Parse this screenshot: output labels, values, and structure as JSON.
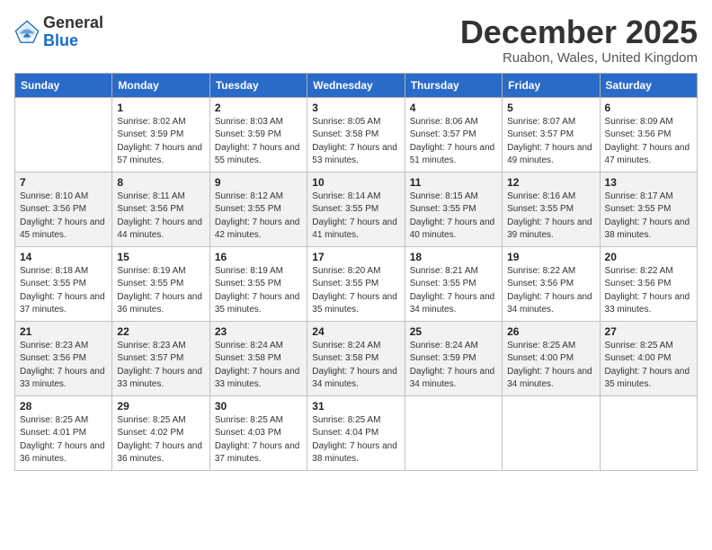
{
  "header": {
    "logo_line1": "General",
    "logo_line2": "Blue",
    "month_year": "December 2025",
    "location": "Ruabon, Wales, United Kingdom"
  },
  "weekdays": [
    "Sunday",
    "Monday",
    "Tuesday",
    "Wednesday",
    "Thursday",
    "Friday",
    "Saturday"
  ],
  "weeks": [
    [
      {
        "day": "",
        "sunrise": "",
        "sunset": "",
        "daylight": ""
      },
      {
        "day": "1",
        "sunrise": "Sunrise: 8:02 AM",
        "sunset": "Sunset: 3:59 PM",
        "daylight": "Daylight: 7 hours and 57 minutes."
      },
      {
        "day": "2",
        "sunrise": "Sunrise: 8:03 AM",
        "sunset": "Sunset: 3:59 PM",
        "daylight": "Daylight: 7 hours and 55 minutes."
      },
      {
        "day": "3",
        "sunrise": "Sunrise: 8:05 AM",
        "sunset": "Sunset: 3:58 PM",
        "daylight": "Daylight: 7 hours and 53 minutes."
      },
      {
        "day": "4",
        "sunrise": "Sunrise: 8:06 AM",
        "sunset": "Sunset: 3:57 PM",
        "daylight": "Daylight: 7 hours and 51 minutes."
      },
      {
        "day": "5",
        "sunrise": "Sunrise: 8:07 AM",
        "sunset": "Sunset: 3:57 PM",
        "daylight": "Daylight: 7 hours and 49 minutes."
      },
      {
        "day": "6",
        "sunrise": "Sunrise: 8:09 AM",
        "sunset": "Sunset: 3:56 PM",
        "daylight": "Daylight: 7 hours and 47 minutes."
      }
    ],
    [
      {
        "day": "7",
        "sunrise": "Sunrise: 8:10 AM",
        "sunset": "Sunset: 3:56 PM",
        "daylight": "Daylight: 7 hours and 45 minutes."
      },
      {
        "day": "8",
        "sunrise": "Sunrise: 8:11 AM",
        "sunset": "Sunset: 3:56 PM",
        "daylight": "Daylight: 7 hours and 44 minutes."
      },
      {
        "day": "9",
        "sunrise": "Sunrise: 8:12 AM",
        "sunset": "Sunset: 3:55 PM",
        "daylight": "Daylight: 7 hours and 42 minutes."
      },
      {
        "day": "10",
        "sunrise": "Sunrise: 8:14 AM",
        "sunset": "Sunset: 3:55 PM",
        "daylight": "Daylight: 7 hours and 41 minutes."
      },
      {
        "day": "11",
        "sunrise": "Sunrise: 8:15 AM",
        "sunset": "Sunset: 3:55 PM",
        "daylight": "Daylight: 7 hours and 40 minutes."
      },
      {
        "day": "12",
        "sunrise": "Sunrise: 8:16 AM",
        "sunset": "Sunset: 3:55 PM",
        "daylight": "Daylight: 7 hours and 39 minutes."
      },
      {
        "day": "13",
        "sunrise": "Sunrise: 8:17 AM",
        "sunset": "Sunset: 3:55 PM",
        "daylight": "Daylight: 7 hours and 38 minutes."
      }
    ],
    [
      {
        "day": "14",
        "sunrise": "Sunrise: 8:18 AM",
        "sunset": "Sunset: 3:55 PM",
        "daylight": "Daylight: 7 hours and 37 minutes."
      },
      {
        "day": "15",
        "sunrise": "Sunrise: 8:19 AM",
        "sunset": "Sunset: 3:55 PM",
        "daylight": "Daylight: 7 hours and 36 minutes."
      },
      {
        "day": "16",
        "sunrise": "Sunrise: 8:19 AM",
        "sunset": "Sunset: 3:55 PM",
        "daylight": "Daylight: 7 hours and 35 minutes."
      },
      {
        "day": "17",
        "sunrise": "Sunrise: 8:20 AM",
        "sunset": "Sunset: 3:55 PM",
        "daylight": "Daylight: 7 hours and 35 minutes."
      },
      {
        "day": "18",
        "sunrise": "Sunrise: 8:21 AM",
        "sunset": "Sunset: 3:55 PM",
        "daylight": "Daylight: 7 hours and 34 minutes."
      },
      {
        "day": "19",
        "sunrise": "Sunrise: 8:22 AM",
        "sunset": "Sunset: 3:56 PM",
        "daylight": "Daylight: 7 hours and 34 minutes."
      },
      {
        "day": "20",
        "sunrise": "Sunrise: 8:22 AM",
        "sunset": "Sunset: 3:56 PM",
        "daylight": "Daylight: 7 hours and 33 minutes."
      }
    ],
    [
      {
        "day": "21",
        "sunrise": "Sunrise: 8:23 AM",
        "sunset": "Sunset: 3:56 PM",
        "daylight": "Daylight: 7 hours and 33 minutes."
      },
      {
        "day": "22",
        "sunrise": "Sunrise: 8:23 AM",
        "sunset": "Sunset: 3:57 PM",
        "daylight": "Daylight: 7 hours and 33 minutes."
      },
      {
        "day": "23",
        "sunrise": "Sunrise: 8:24 AM",
        "sunset": "Sunset: 3:58 PM",
        "daylight": "Daylight: 7 hours and 33 minutes."
      },
      {
        "day": "24",
        "sunrise": "Sunrise: 8:24 AM",
        "sunset": "Sunset: 3:58 PM",
        "daylight": "Daylight: 7 hours and 34 minutes."
      },
      {
        "day": "25",
        "sunrise": "Sunrise: 8:24 AM",
        "sunset": "Sunset: 3:59 PM",
        "daylight": "Daylight: 7 hours and 34 minutes."
      },
      {
        "day": "26",
        "sunrise": "Sunrise: 8:25 AM",
        "sunset": "Sunset: 4:00 PM",
        "daylight": "Daylight: 7 hours and 34 minutes."
      },
      {
        "day": "27",
        "sunrise": "Sunrise: 8:25 AM",
        "sunset": "Sunset: 4:00 PM",
        "daylight": "Daylight: 7 hours and 35 minutes."
      }
    ],
    [
      {
        "day": "28",
        "sunrise": "Sunrise: 8:25 AM",
        "sunset": "Sunset: 4:01 PM",
        "daylight": "Daylight: 7 hours and 36 minutes."
      },
      {
        "day": "29",
        "sunrise": "Sunrise: 8:25 AM",
        "sunset": "Sunset: 4:02 PM",
        "daylight": "Daylight: 7 hours and 36 minutes."
      },
      {
        "day": "30",
        "sunrise": "Sunrise: 8:25 AM",
        "sunset": "Sunset: 4:03 PM",
        "daylight": "Daylight: 7 hours and 37 minutes."
      },
      {
        "day": "31",
        "sunrise": "Sunrise: 8:25 AM",
        "sunset": "Sunset: 4:04 PM",
        "daylight": "Daylight: 7 hours and 38 minutes."
      },
      {
        "day": "",
        "sunrise": "",
        "sunset": "",
        "daylight": ""
      },
      {
        "day": "",
        "sunrise": "",
        "sunset": "",
        "daylight": ""
      },
      {
        "day": "",
        "sunrise": "",
        "sunset": "",
        "daylight": ""
      }
    ]
  ]
}
